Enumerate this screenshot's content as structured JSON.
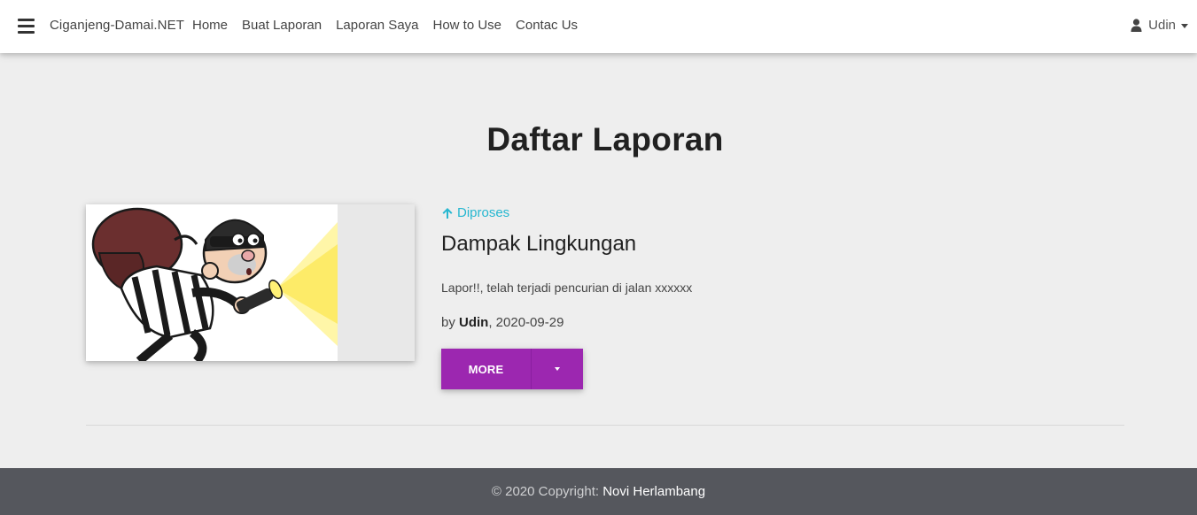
{
  "navbar": {
    "brand": "Ciganjeng-Damai.NET",
    "links": [
      "Home",
      "Buat Laporan",
      "Laporan Saya",
      "How to Use",
      "Contac Us"
    ],
    "user": "Udin"
  },
  "main": {
    "title": "Daftar Laporan",
    "report": {
      "status": "Diproses",
      "title": "Dampak Lingkungan",
      "excerpt": "Lapor!!, telah terjadi pencurian di jalan xxxxxx",
      "by_label": "by",
      "author": "Udin",
      "date": ", 2020-09-29",
      "more_label": "MORE"
    }
  },
  "footer": {
    "copyright": "© 2020 Copyright: ",
    "author": "Novi Herlambang"
  },
  "colors": {
    "accent": "#9c27b0",
    "status": "#26b7d0",
    "footer": "#55575d"
  }
}
